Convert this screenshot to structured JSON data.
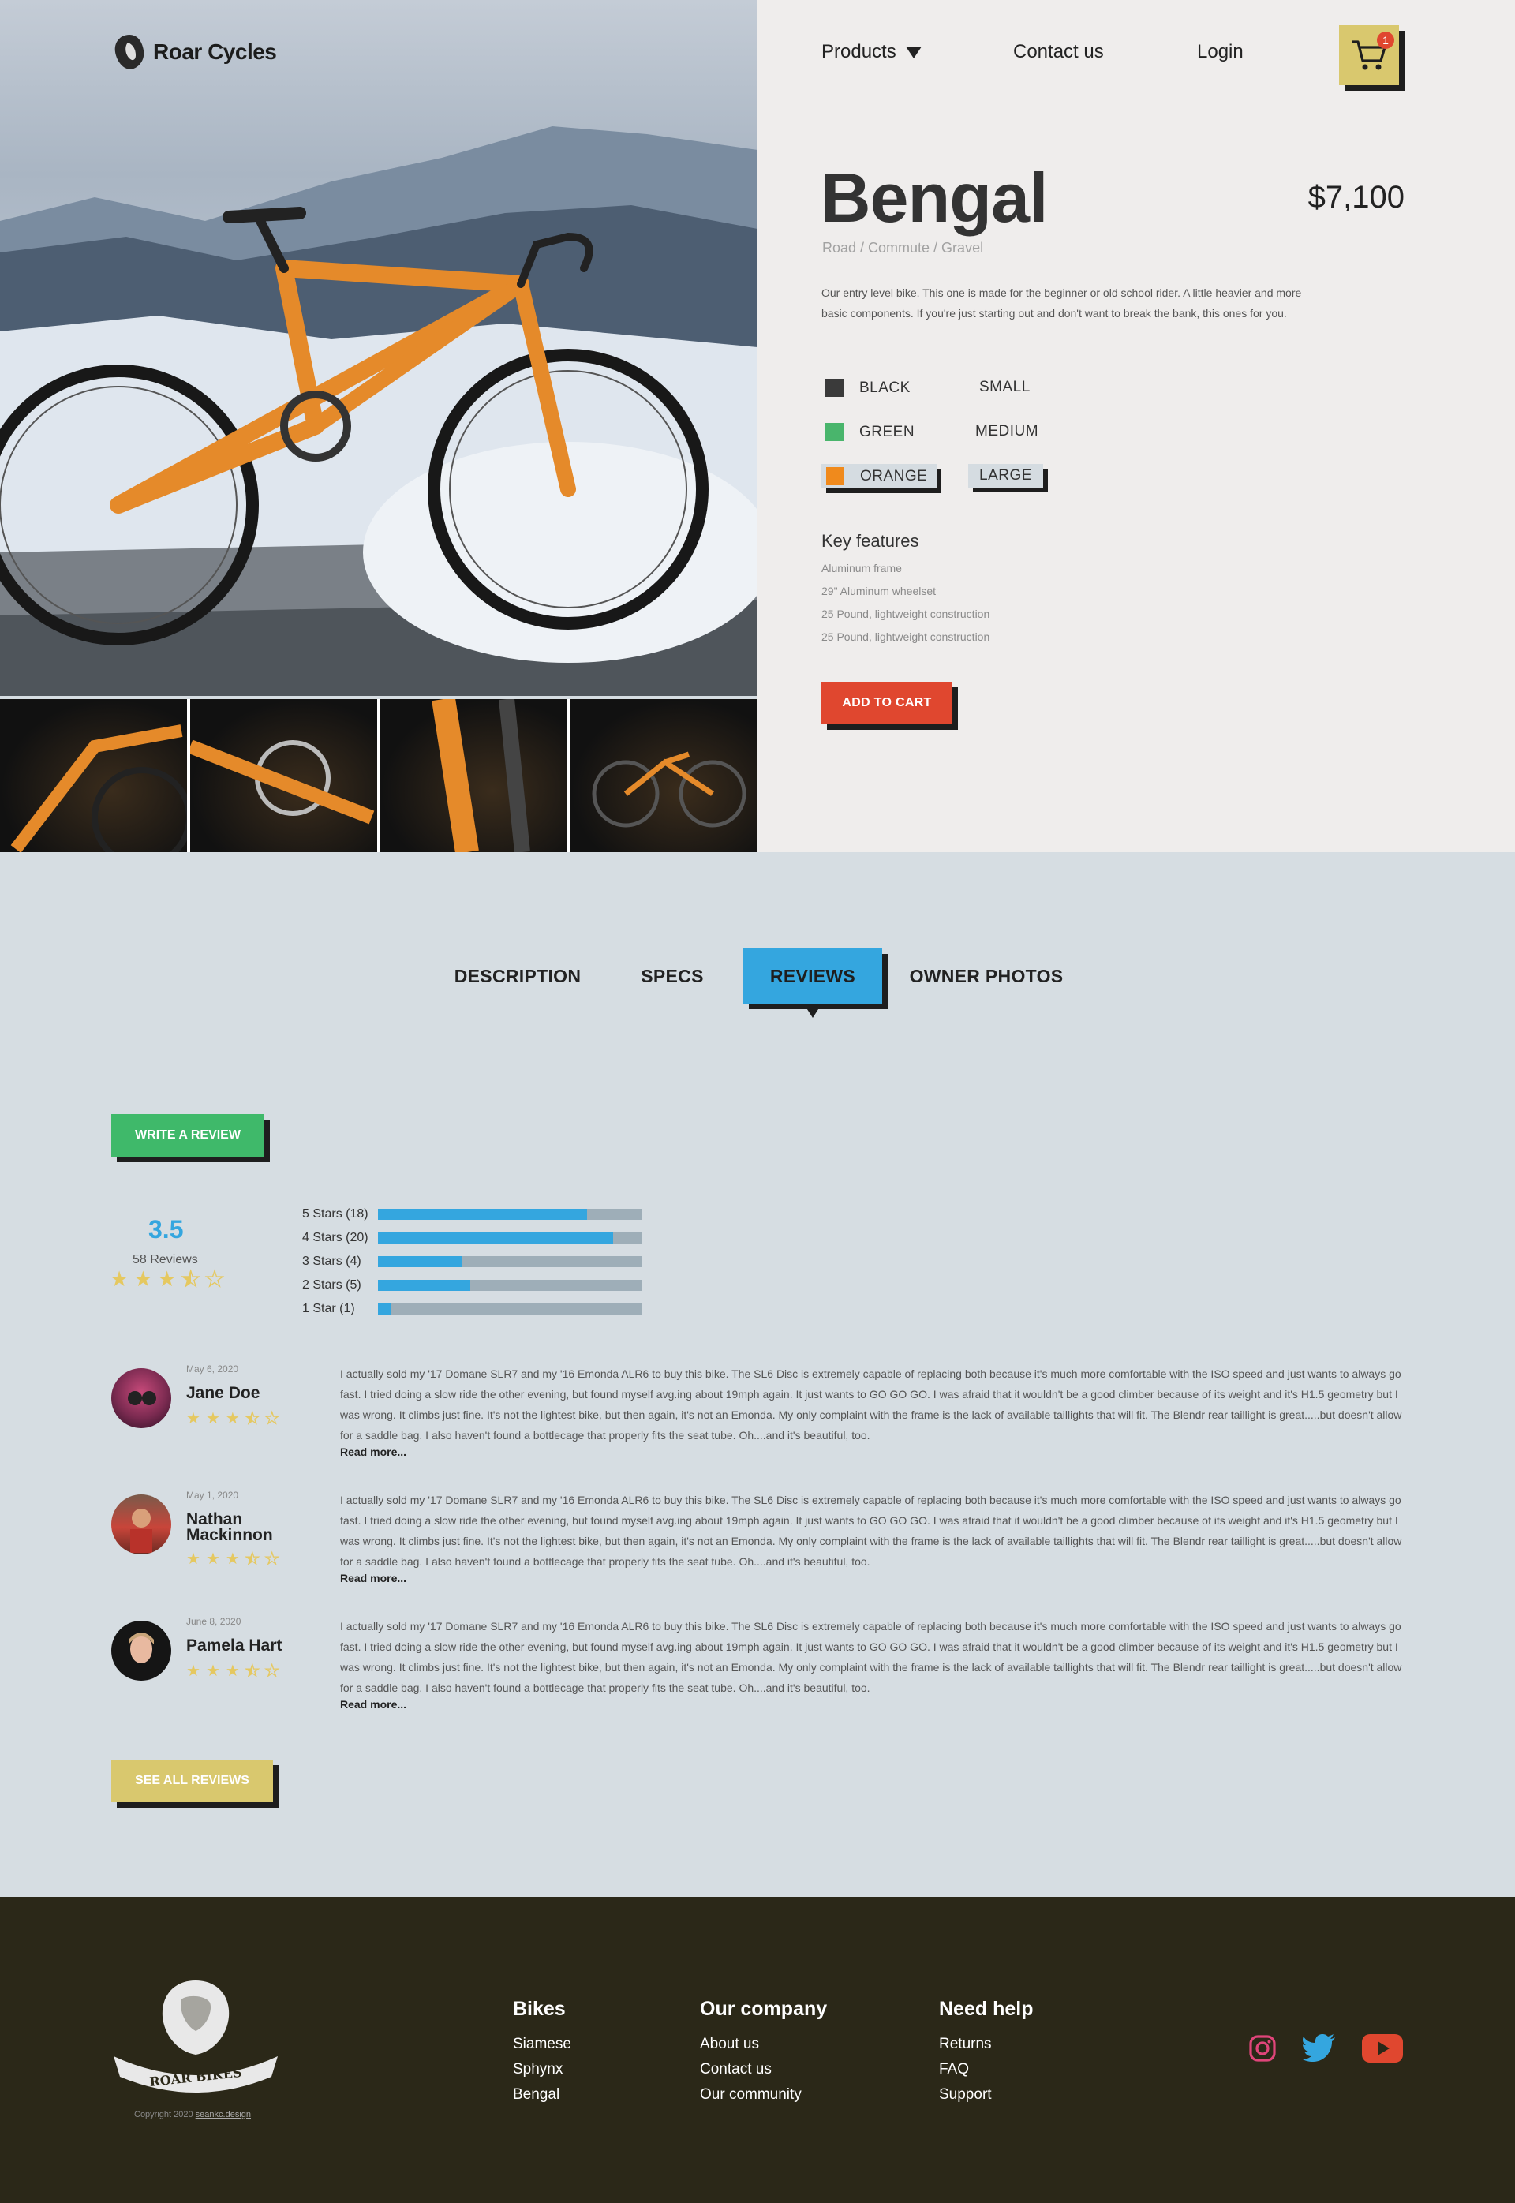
{
  "brand": {
    "name": "Roar Cycles",
    "footer_brand": "ROAR BIKES"
  },
  "nav": {
    "products": "Products",
    "contact": "Contact us",
    "login": "Login",
    "cart_count": "1"
  },
  "product": {
    "name": "Bengal",
    "price": "$7,100",
    "categories": "Road / Commute / Gravel",
    "description": "Our entry level bike. This one is made for the beginner or old school rider. A little heavier and more basic components. If you're just starting out and don't want to break the bank, this ones for you.",
    "colors": [
      {
        "label": "BLACK",
        "hex": "#3a3a3a"
      },
      {
        "label": "GREEN",
        "hex": "#49b56c"
      },
      {
        "label": "ORANGE",
        "hex": "#f08a1c",
        "selected": true
      }
    ],
    "sizes": [
      {
        "label": "SMALL"
      },
      {
        "label": "MEDIUM"
      },
      {
        "label": "LARGE",
        "selected": true
      }
    ],
    "key_features_title": "Key features",
    "key_features": [
      "Aluminum frame",
      "29\" Aluminum wheelset",
      "25 Pound, lightweight construction",
      "25 Pound, lightweight construction"
    ],
    "add_to_cart": "ADD TO CART"
  },
  "tabs": [
    {
      "label": "DESCRIPTION"
    },
    {
      "label": "SPECS"
    },
    {
      "label": "REVIEWS",
      "active": true
    },
    {
      "label": "OWNER PHOTOS"
    }
  ],
  "reviews": {
    "write_button": "WRITE A REVIEW",
    "average": "3.5",
    "average_value": 3.5,
    "count_label": "58 Reviews",
    "breakdown": [
      {
        "label": "5 Stars (18)",
        "fraction": 0.79
      },
      {
        "label": "4 Stars (20)",
        "fraction": 0.89
      },
      {
        "label": "3 Stars (4)",
        "fraction": 0.32
      },
      {
        "label": "2 Stars (5)",
        "fraction": 0.35
      },
      {
        "label": "1 Star (1)",
        "fraction": 0.05
      }
    ],
    "items": [
      {
        "date": "May 6, 2020",
        "name": "Jane Doe",
        "rating": 3.5,
        "text": "I actually sold my '17 Domane SLR7 and my '16 Emonda ALR6 to buy this bike. The SL6 Disc is extremely capable of replacing both because it's much more comfortable with the ISO speed and just wants to always go fast. I tried doing a slow ride the other evening, but found myself avg.ing about 19mph again. It just wants to GO GO GO. I was afraid that it wouldn't be a good climber because of its weight and it's H1.5 geometry but I was wrong. It climbs just fine. It's not the lightest bike, but then again, it's not an Emonda. My only complaint with the frame is the lack of available taillights that will fit. The Blendr rear taillight is great.....but doesn't allow for a saddle bag. I also haven't found a bottlecage that properly fits the seat tube. Oh....and it's beautiful, too.",
        "more": "Read more..."
      },
      {
        "date": "May 1, 2020",
        "name": "Nathan Mackinnon",
        "rating": 3.5,
        "text": "I actually sold my '17 Domane SLR7 and my '16 Emonda ALR6 to buy this bike. The SL6 Disc is extremely capable of replacing both because it's much more comfortable with the ISO speed and just wants to always go fast. I tried doing a slow ride the other evening, but found myself avg.ing about 19mph again. It just wants to GO GO GO. I was afraid that it wouldn't be a good climber because of its weight and it's H1.5 geometry but I was wrong. It climbs just fine. It's not the lightest bike, but then again, it's not an Emonda. My only complaint with the frame is the lack of available taillights that will fit. The Blendr rear taillight is great.....but doesn't allow for a saddle bag. I also haven't found a bottlecage that properly fits the seat tube. Oh....and it's beautiful, too.",
        "more": "Read more..."
      },
      {
        "date": "June 8, 2020",
        "name": "Pamela Hart",
        "rating": 3.5,
        "text": "I actually sold my '17 Domane SLR7 and my '16 Emonda ALR6 to buy this bike. The SL6 Disc is extremely capable of replacing both because it's much more comfortable with the ISO speed and just wants to always go fast. I tried doing a slow ride the other evening, but found myself avg.ing about 19mph again. It just wants to GO GO GO. I was afraid that it wouldn't be a good climber because of its weight and it's H1.5 geometry but I was wrong. It climbs just fine. It's not the lightest bike, but then again, it's not an Emonda. My only complaint with the frame is the lack of available taillights that will fit. The Blendr rear taillight is great.....but doesn't allow for a saddle bag. I also haven't found a bottlecage that properly fits the seat tube. Oh....and it's beautiful, too.",
        "more": "Read more..."
      }
    ],
    "see_all": "SEE ALL REVIEWS"
  },
  "footer": {
    "copyright": "Copyright 2020",
    "credit": "seankc.design",
    "columns": [
      {
        "title": "Bikes",
        "links": [
          "Siamese",
          "Sphynx",
          "Bengal"
        ]
      },
      {
        "title": "Our company",
        "links": [
          "About us",
          "Contact us",
          "Our community"
        ]
      },
      {
        "title": "Need help",
        "links": [
          "Returns",
          "FAQ",
          "Support"
        ]
      }
    ],
    "social": [
      "instagram-icon",
      "twitter-icon",
      "youtube-icon"
    ]
  },
  "colors": {
    "accent_blue": "#34a6df",
    "accent_red": "#e0472f",
    "accent_green": "#3fb96a",
    "accent_gold": "#d9c86e",
    "footer_bg": "#2b2818"
  }
}
